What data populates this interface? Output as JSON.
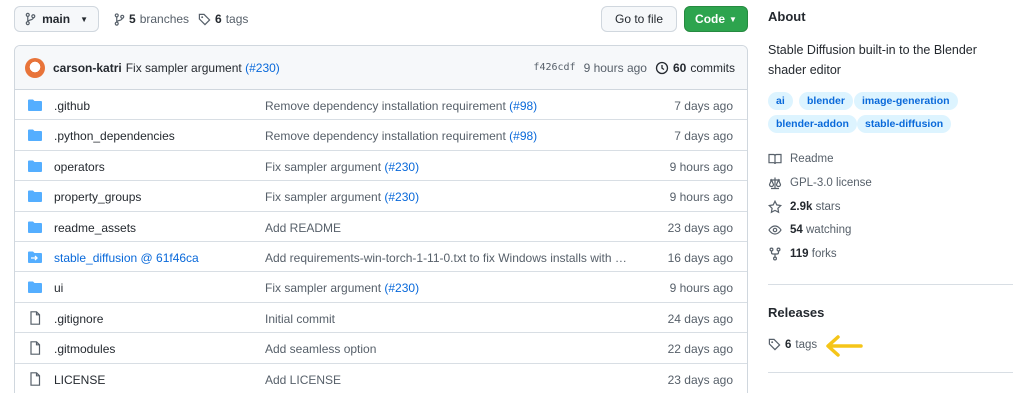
{
  "toolbar": {
    "branch_label": "main",
    "branches_count": "5",
    "branches_label": "branches",
    "tags_count": "6",
    "tags_label": "tags",
    "goto_file_label": "Go to file",
    "code_label": "Code"
  },
  "latest_commit": {
    "author": "carson-katri",
    "message": "Fix sampler argument",
    "pr": "(#230)",
    "sha": "f426cdf",
    "time": "9 hours ago",
    "commits_count": "60",
    "commits_label": "commits"
  },
  "files": [
    {
      "name": ".github",
      "kind": "folder",
      "msg": "Remove dependency installation requirement",
      "pr": "(#98)",
      "age": "7 days ago"
    },
    {
      "name": ".python_dependencies",
      "kind": "folder",
      "msg": "Remove dependency installation requirement",
      "pr": "(#98)",
      "age": "7 days ago"
    },
    {
      "name": "operators",
      "kind": "folder",
      "msg": "Fix sampler argument",
      "pr": "(#230)",
      "age": "9 hours ago"
    },
    {
      "name": "property_groups",
      "kind": "folder",
      "msg": "Fix sampler argument",
      "pr": "(#230)",
      "age": "9 hours ago"
    },
    {
      "name": "readme_assets",
      "kind": "folder",
      "msg": "Add README",
      "pr": "",
      "age": "23 days ago"
    },
    {
      "name": "stable_diffusion @ 61f46ca",
      "kind": "submodule",
      "msg": "Add requirements-win-torch-1-11-0.txt to fix Windows installs with Py...",
      "pr": "",
      "age": "16 days ago"
    },
    {
      "name": "ui",
      "kind": "folder",
      "msg": "Fix sampler argument",
      "pr": "(#230)",
      "age": "9 hours ago"
    },
    {
      "name": ".gitignore",
      "kind": "file",
      "msg": "Initial commit",
      "pr": "",
      "age": "24 days ago"
    },
    {
      "name": ".gitmodules",
      "kind": "file",
      "msg": "Add seamless option",
      "pr": "",
      "age": "22 days ago"
    },
    {
      "name": "LICENSE",
      "kind": "file",
      "msg": "Add LICENSE",
      "pr": "",
      "age": "23 days ago"
    }
  ],
  "about": {
    "heading": "About",
    "description": "Stable Diffusion built-in to the Blender shader editor",
    "topics": [
      "ai",
      "blender",
      "image-generation",
      "blender-addon",
      "stable-diffusion"
    ],
    "readme": "Readme",
    "license": "GPL-3.0 license",
    "stars_count": "2.9k",
    "stars_label": "stars",
    "watching_count": "54",
    "watching_label": "watching",
    "forks_count": "119",
    "forks_label": "forks"
  },
  "releases": {
    "heading": "Releases",
    "tags_count": "6",
    "tags_label": "tags"
  },
  "colors": {
    "folder": "#54aeff",
    "code_button": "#2da44e",
    "link": "#0969da",
    "highlight_arrow": "#f5c518"
  }
}
